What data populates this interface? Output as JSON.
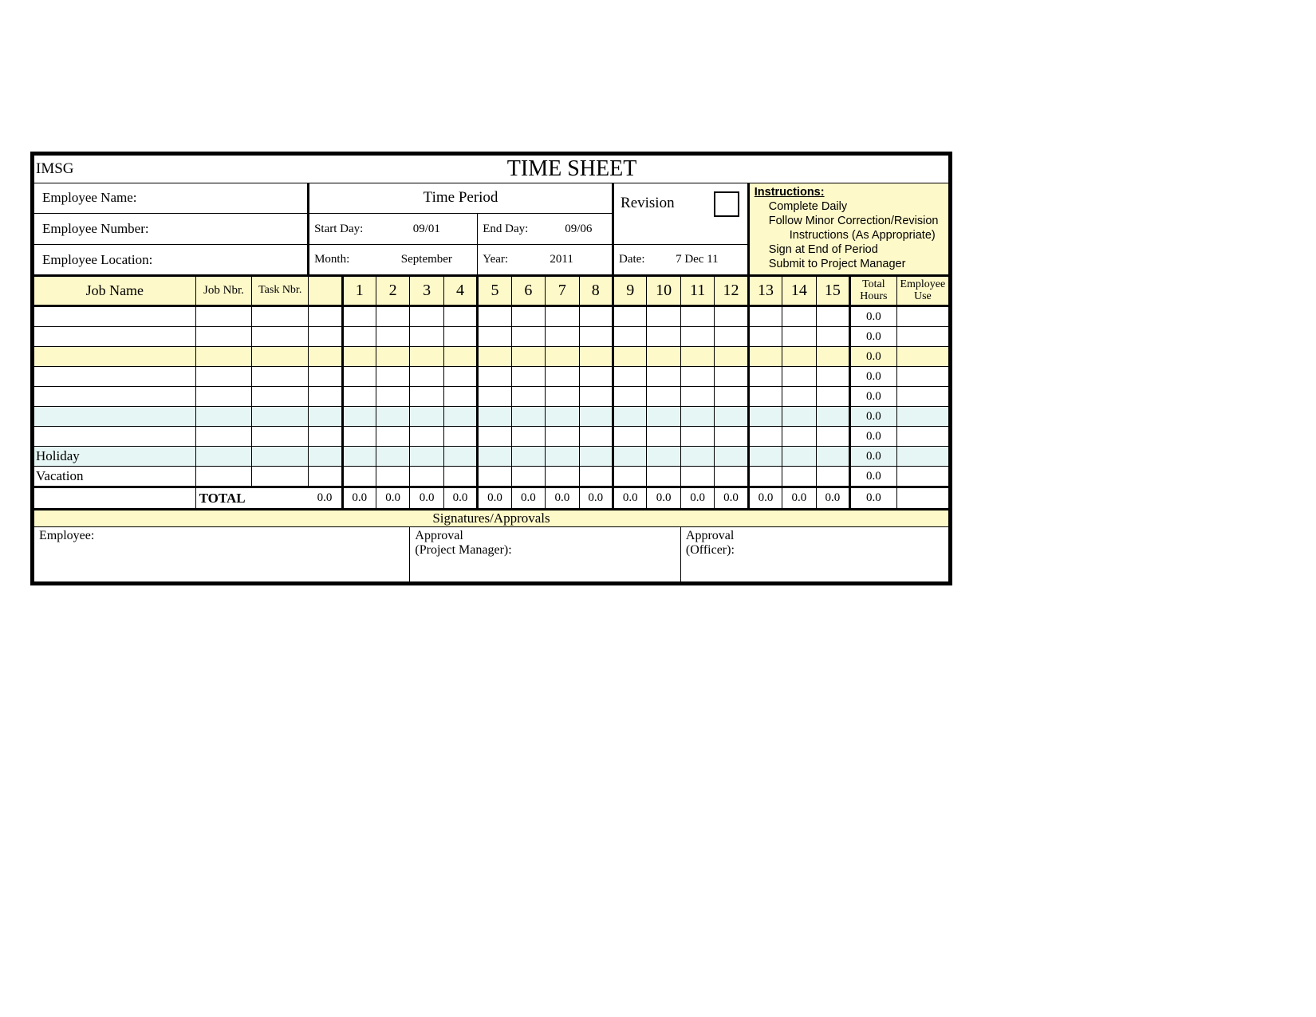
{
  "org": "IMSG",
  "title": "TIME SHEET",
  "labels": {
    "employee_name": "Employee Name:",
    "employee_number": "Employee Number:",
    "employee_location": "Employee Location:",
    "time_period": "Time Period",
    "start_day": "Start Day:",
    "end_day": "End Day:",
    "month": "Month:",
    "year": "Year:",
    "revision": "Revision",
    "date": "Date:",
    "job_name": "Job Name",
    "job_nbr": "Job Nbr.",
    "task_nbr": "Task Nbr.",
    "total_hours_l1": "Total",
    "total_hours_l2": "Hours",
    "employee_use_l1": "Employee",
    "employee_use_l2": "Use",
    "holiday": "Holiday",
    "vacation": "Vacation",
    "total": "TOTAL",
    "sig_bar": "Signatures/Approvals",
    "sig_employee": "Employee:",
    "sig_pm_l1": "Approval",
    "sig_pm_l2": "(Project Manager):",
    "sig_off_l1": "Approval",
    "sig_off_l2": "(Officer):"
  },
  "values": {
    "start_day": "09/01",
    "end_day": "09/06",
    "month": "September",
    "year": "2011",
    "date": "7 Dec 11"
  },
  "instructions": {
    "heading": "Instructions:",
    "line1": "Complete Daily",
    "line2a": "Follow Minor Correction/Revision",
    "line2b": "Instructions (As Appropriate)",
    "line3": "Sign at End of Period",
    "line4": "Submit to Project Manager"
  },
  "days": [
    "1",
    "2",
    "3",
    "4",
    "5",
    "6",
    "7",
    "8",
    "9",
    "10",
    "11",
    "12",
    "13",
    "14",
    "15"
  ],
  "rows": [
    {
      "name": "",
      "style": "",
      "total": "0.0"
    },
    {
      "name": "",
      "style": "",
      "total": "0.0"
    },
    {
      "name": "",
      "style": "yellow",
      "total": "0.0"
    },
    {
      "name": "",
      "style": "",
      "total": "0.0"
    },
    {
      "name": "",
      "style": "",
      "total": "0.0"
    },
    {
      "name": "",
      "style": "blue",
      "total": "0.0"
    },
    {
      "name": "",
      "style": "",
      "total": "0.0"
    },
    {
      "name": "Holiday",
      "style": "blue",
      "total": "0.0"
    },
    {
      "name": "Vacation",
      "style": "",
      "total": "0.0"
    }
  ],
  "totals": {
    "cells": [
      "0.0",
      "0.0",
      "0.0",
      "0.0",
      "0.0",
      "0.0",
      "0.0",
      "0.0",
      "0.0",
      "0.0",
      "0.0",
      "0.0",
      "0.0",
      "0.0",
      "0.0",
      "0.0"
    ],
    "grand": "0.0"
  }
}
